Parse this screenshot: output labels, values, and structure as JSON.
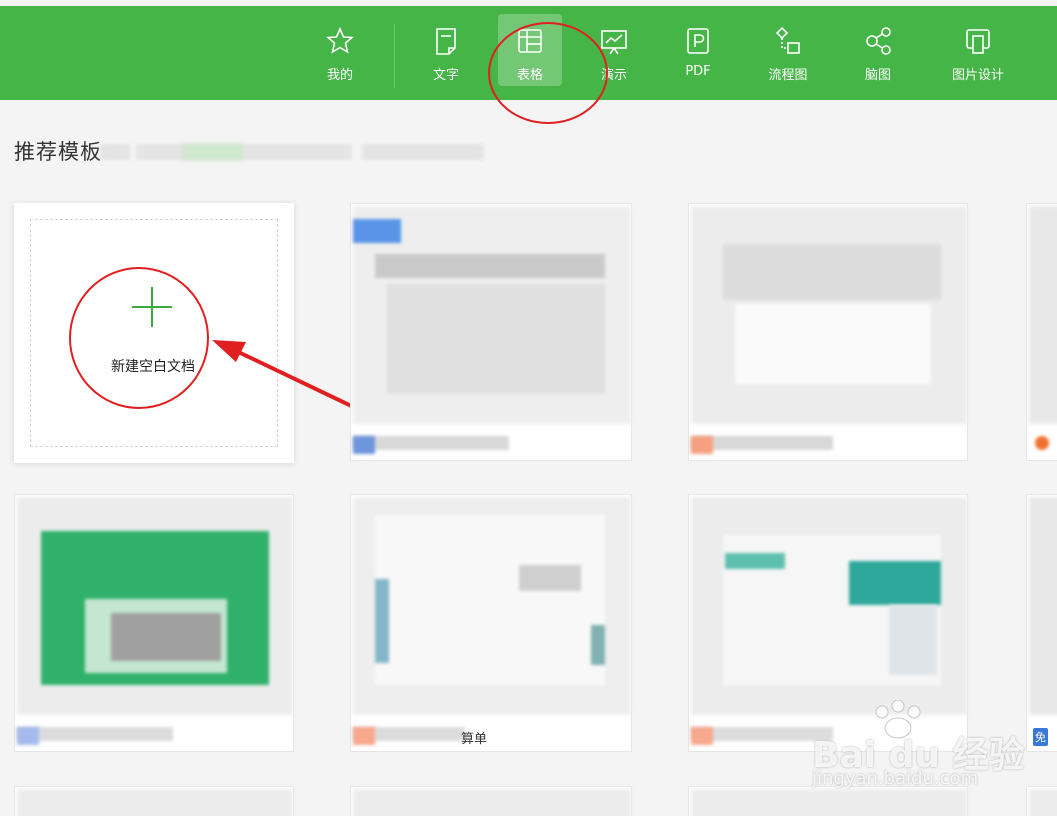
{
  "nav": {
    "tabs": [
      {
        "label": "我的",
        "icon": "star-icon"
      },
      {
        "label": "文字",
        "icon": "document-icon"
      },
      {
        "label": "表格",
        "icon": "spreadsheet-icon",
        "active": true
      },
      {
        "label": "演示",
        "icon": "presentation-icon"
      },
      {
        "label": "PDF",
        "icon": "pdf-icon"
      },
      {
        "label": "流程图",
        "icon": "flowchart-icon"
      },
      {
        "label": "脑图",
        "icon": "mindmap-icon"
      },
      {
        "label": "图片设计",
        "icon": "image-design-icon"
      }
    ],
    "bg_color": "#45b547"
  },
  "section": {
    "title": "推荐模板"
  },
  "new_doc": {
    "label": "新建空白文档"
  },
  "templates": [
    {
      "caption": ""
    },
    {
      "caption": ""
    },
    {
      "caption": ""
    },
    {
      "caption": "算单"
    },
    {
      "caption": ""
    },
    {
      "caption": ""
    }
  ],
  "badges": {
    "right_top": "",
    "right_bottom": "免"
  },
  "watermark": {
    "brand": "Bai du 经验",
    "url": "jingyan.baidu.com"
  },
  "annotation_color": "#e02020"
}
